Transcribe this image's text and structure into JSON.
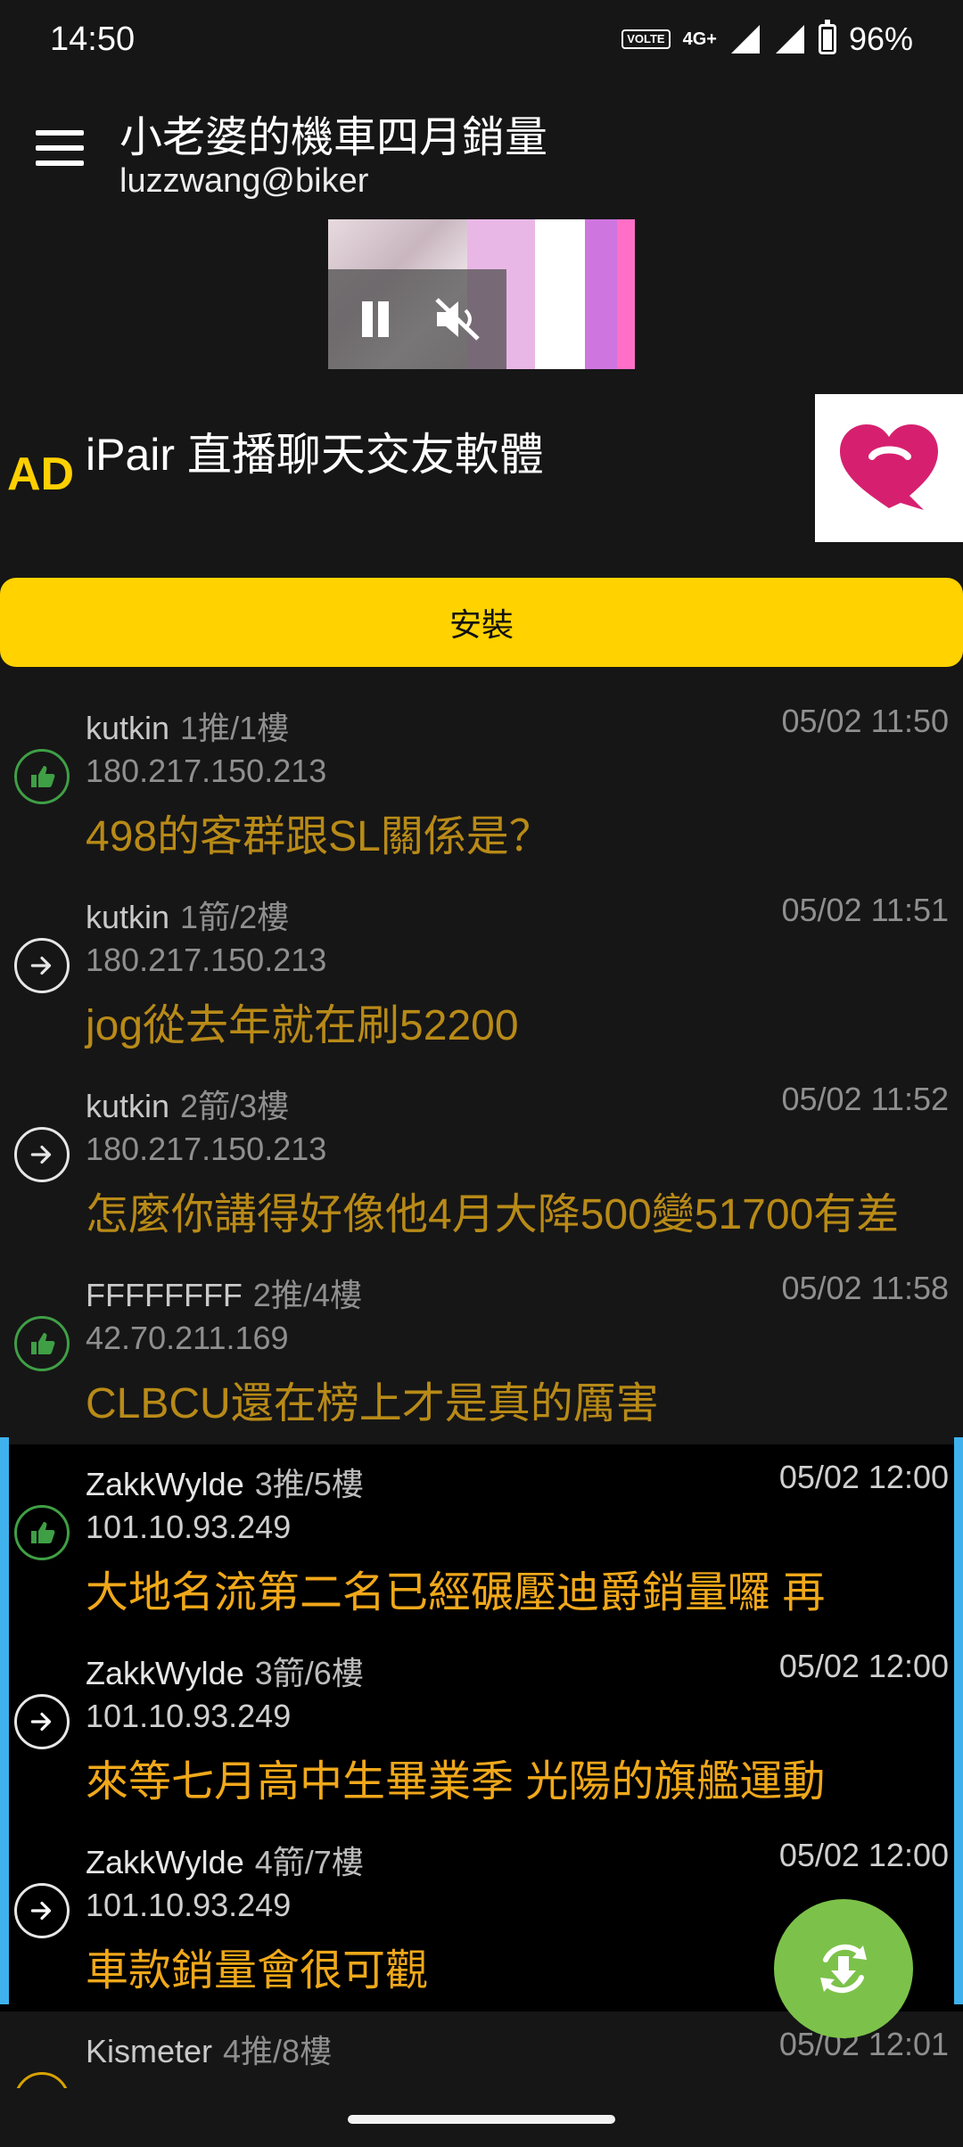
{
  "status_bar": {
    "time": "14:50",
    "volte": "VOLTE",
    "network": "4G+",
    "battery": "96%"
  },
  "app_bar": {
    "title": "小老婆的機車四月銷量",
    "subtitle": "luzzwang@biker"
  },
  "ad": {
    "label": "AD",
    "text": "iPair 直播聊天交友軟體",
    "install_label": "安裝",
    "install_color": "#ffd200"
  },
  "comments": [
    {
      "user": "kutkin",
      "floor": "1推/1樓",
      "time": "05/02 11:50",
      "ip": "180.217.150.213",
      "text": "498的客群跟SL關係是？",
      "type": "push",
      "highlight": false
    },
    {
      "user": "kutkin",
      "floor": "1箭/2樓",
      "time": "05/02 11:51",
      "ip": "180.217.150.213",
      "text": "jog從去年就在刷52200",
      "type": "arrow",
      "highlight": false
    },
    {
      "user": "kutkin",
      "floor": "2箭/3樓",
      "time": "05/02 11:52",
      "ip": "180.217.150.213",
      "text": "怎麼你講得好像他4月大降500變51700有差",
      "type": "arrow",
      "highlight": false
    },
    {
      "user": "FFFFFFFF",
      "floor": "2推/4樓",
      "time": "05/02 11:58",
      "ip": "42.70.211.169",
      "text": "CLBCU還在榜上才是真的厲害",
      "type": "push",
      "highlight": false
    },
    {
      "user": "ZakkWylde",
      "floor": "3推/5樓",
      "time": "05/02 12:00",
      "ip": "101.10.93.249",
      "text": "大地名流第二名已經碾壓迪爵銷量囉 再",
      "type": "push",
      "highlight": true
    },
    {
      "user": "ZakkWylde",
      "floor": "3箭/6樓",
      "time": "05/02 12:00",
      "ip": "101.10.93.249",
      "text": "來等七月高中生畢業季 光陽的旗艦運動",
      "type": "arrow",
      "highlight": true
    },
    {
      "user": "ZakkWylde",
      "floor": "4箭/7樓",
      "time": "05/02 12:00",
      "ip": "101.10.93.249",
      "text": "車款銷量會很可觀",
      "type": "arrow",
      "highlight": true
    },
    {
      "user": "Kismeter",
      "floor": "4推/8樓",
      "time": "05/02 12:01",
      "ip": "",
      "text": "",
      "type": "boo",
      "highlight": false
    }
  ],
  "colors": {
    "push": "#3f9f45",
    "arrow": "#e6e6e6",
    "highlight_bar": "#3fb2ee",
    "fab": "#7cc24a"
  },
  "icons": {
    "menu": "hamburger-icon",
    "pause": "pause-icon",
    "mute": "volume-off-icon",
    "push": "thumbs-up-icon",
    "arrow": "arrow-right-circle-icon",
    "fab": "refresh-download-icon"
  }
}
